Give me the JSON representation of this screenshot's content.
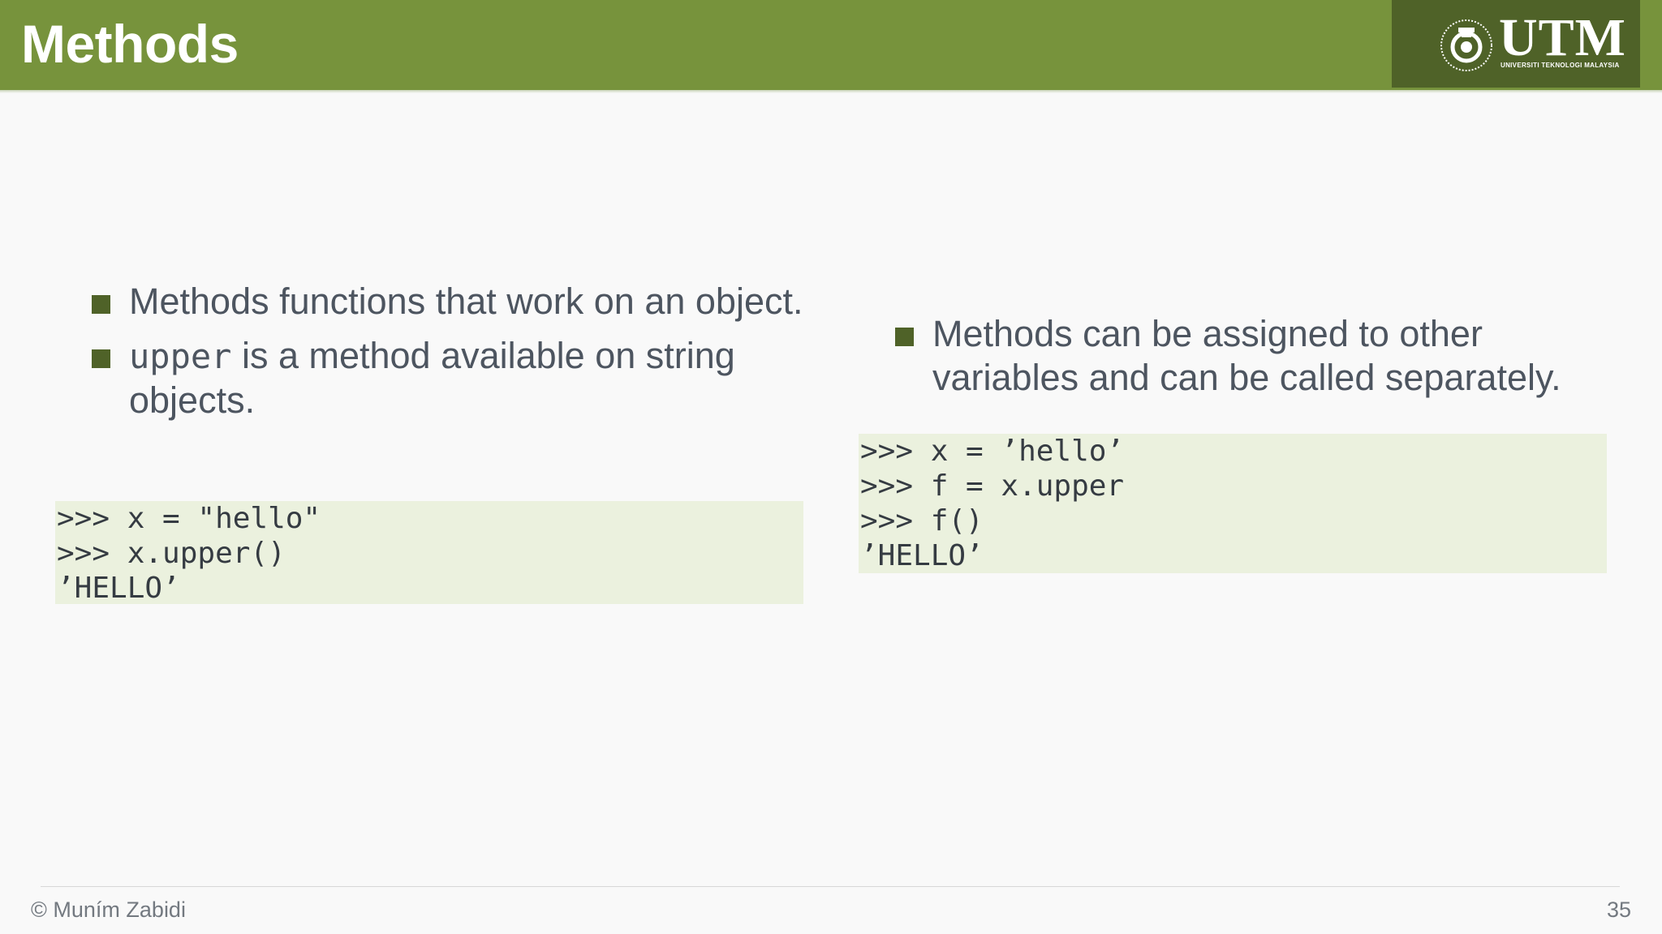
{
  "header": {
    "title": "Methods",
    "logo": {
      "name": "UTM",
      "subtitle": "UNIVERSITI TEKNOLOGI MALAYSIA",
      "emblem_icon": "utm-emblem-icon"
    }
  },
  "left": {
    "bullets": [
      {
        "text": "Methods functions that work on an object."
      },
      {
        "code": "upper",
        "text": " is a method available on string objects."
      }
    ],
    "code": ">>> x = \"hello\"\n>>> x.upper()\n’HELLO’"
  },
  "right": {
    "bullets": [
      {
        "text": "Methods can be assigned to other variables and can be called separately."
      }
    ],
    "code": ">>> x = ’hello’\n>>> f = x.upper\n>>> f()\n’HELLO’"
  },
  "footer": {
    "author": "© Muním Zabidi",
    "page_number": "35"
  },
  "colors": {
    "header_bg": "#77933c",
    "logo_bg": "#4f6228",
    "bullet": "#4f6228",
    "code_bg": "#ebf1de"
  }
}
